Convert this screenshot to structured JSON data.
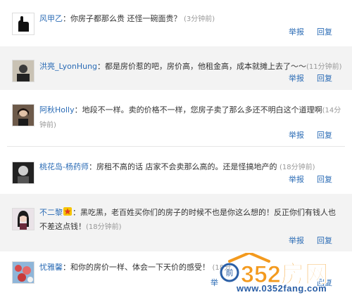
{
  "comments": [
    {
      "user": "风甲乙",
      "separator": "：",
      "body": "你房子都那么贵 还怪一碗面贵？",
      "time": "(3分钟前)",
      "report": "举报",
      "reply": "回复"
    },
    {
      "user": "洪亮_LyonHung",
      "separator": "：",
      "body": "都是房价惹的吧，房价高，他租金高，成本就摊上去了～～",
      "time": "(11分钟前)",
      "report": "举报",
      "reply": "回复"
    },
    {
      "user": "阿秋Holly",
      "separator": "：",
      "body": "地段不一样。卖的价格不一样，您房子卖了那么多还不明白这个道理啊",
      "time": "(14分钟前)",
      "report": "举报",
      "reply": "回复"
    },
    {
      "user": "桃花岛-杨药师",
      "separator": "：",
      "body": "房租不高的话 店家不会卖那么高的。还是怪搞地产的",
      "time": "(18分钟前)",
      "report": "举报",
      "reply": "回复"
    },
    {
      "user": "不二黎",
      "separator": "：",
      "body": "黑吃黑，老百姓买你们的房子的时候不也是你这么想的！反正你们有钱人也不差这点钱！",
      "time": "(18分钟前)",
      "report": "举报",
      "reply": "回复"
    },
    {
      "user": "忧雅馨",
      "separator": "：",
      "body": "和你的房价一样、体会一下天价的感受！",
      "time": "(18分",
      "report": "举",
      "reply": "回复"
    }
  ],
  "watermark": {
    "brand": "352房网",
    "url": "www.0352fang.com"
  },
  "colors": {
    "link": "#2a6bb5",
    "watermark_orange": "#f39a1e",
    "watermark_blue": "#2b5fa6"
  }
}
